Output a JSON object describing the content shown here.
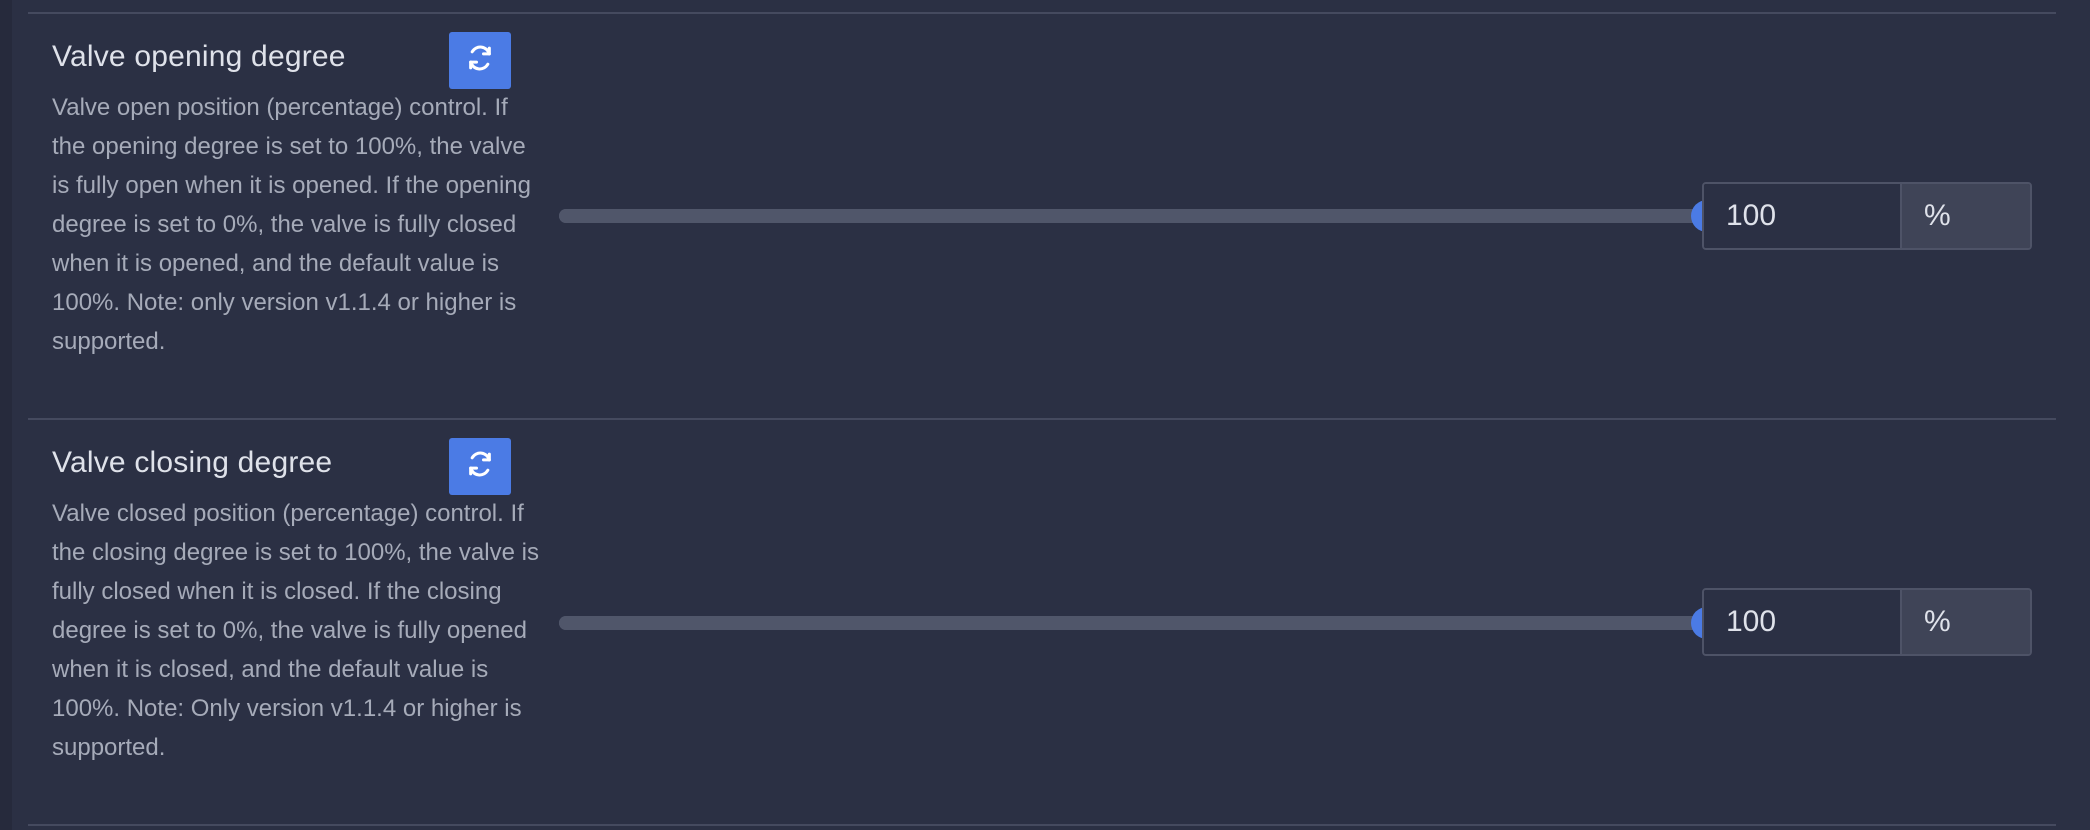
{
  "settings": [
    {
      "title": "Valve opening degree",
      "description": "Valve open position (percentage) control. If the opening degree is set to 100%, the valve is fully open when it is opened. If the opening degree is set to 0%, the valve is fully closed when it is opened, and the default value is 100%. Note: only version v1.1.4 or higher is supported.",
      "value": "100",
      "unit": "%",
      "slider_fraction": 1.0,
      "reset_icon": "refresh-icon"
    },
    {
      "title": "Valve closing degree",
      "description": "Valve closed position (percentage) control. If the closing degree is set to 100%, the valve is fully closed when it is closed. If the closing degree is set to 0%, the valve is fully opened when it is closed, and the default value is 100%. Note: Only version v1.1.4 or higher is supported.",
      "value": "100",
      "unit": "%",
      "slider_fraction": 1.0,
      "reset_icon": "refresh-icon"
    }
  ],
  "colors": {
    "background": "#2b3044",
    "accent": "#4b7be5",
    "text": "#dfe2ea",
    "muted_text": "#a6abb9",
    "track": "#50566a"
  }
}
